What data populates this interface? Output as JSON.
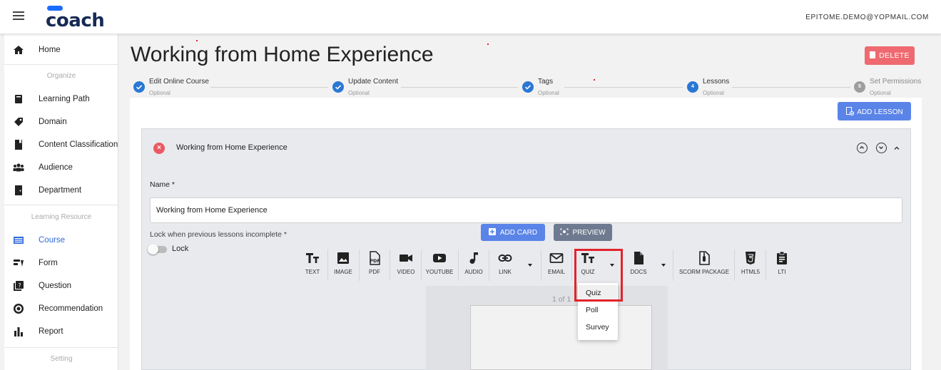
{
  "header": {
    "logo_text": "coach",
    "user_email": "EPITOME.DEMO@YOPMAIL.COM"
  },
  "sidebar": {
    "home": "Home",
    "section_organize": "Organize",
    "learning_path": "Learning Path",
    "domain": "Domain",
    "content_classification": "Content Classification",
    "audience": "Audience",
    "department": "Department",
    "section_learning_resource": "Learning Resource",
    "course": "Course",
    "form": "Form",
    "question": "Question",
    "recommendation": "Recommendation",
    "report": "Report",
    "section_setting": "Setting",
    "active_item": "Course"
  },
  "page": {
    "title": "Working from Home Experience",
    "delete_label": "DELETE"
  },
  "stepper": {
    "steps": [
      {
        "label": "Edit Online Course",
        "sub": "Optional",
        "state": "done",
        "number": ""
      },
      {
        "label": "Update Content",
        "sub": "Optional",
        "state": "done",
        "number": ""
      },
      {
        "label": "Tags",
        "sub": "Optional",
        "state": "done",
        "number": ""
      },
      {
        "label": "Lessons",
        "sub": "Optional",
        "state": "active",
        "number": "4"
      },
      {
        "label": "Set Permissions",
        "sub": "Optional",
        "state": "pending",
        "number": "5"
      }
    ]
  },
  "lessons": {
    "add_lesson_label": "ADD LESSON",
    "panel_title": "Working from Home Experience",
    "name_label": "Name *",
    "name_value": "Working from Home Experience",
    "lock_label": "Lock when previous lessons incomplete *",
    "lock_toggle_label": "Lock",
    "add_card_label": "ADD CARD",
    "preview_label": "PREVIEW",
    "page_counter": "1 of 1"
  },
  "toolbar": {
    "text": "TEXT",
    "image": "IMAGE",
    "pdf": "PDF",
    "video": "VIDEO",
    "youtube": "YOUTUBE",
    "audio": "AUDIO",
    "link": "LINK",
    "email": "EMAIL",
    "quiz": "QUIZ",
    "docs": "DOCS",
    "scorm": "SCORM PACKAGE",
    "html5": "HTML5",
    "lti": "LTI"
  },
  "quiz_menu": {
    "items": [
      "Quiz",
      "Poll",
      "Survey"
    ],
    "highlighted": "Quiz"
  },
  "colors": {
    "primary": "#2a77d4",
    "button_blue": "#5b84e8",
    "danger": "#ef6a70",
    "highlight_red": "#e3232b",
    "brand_navy": "#172a54"
  }
}
